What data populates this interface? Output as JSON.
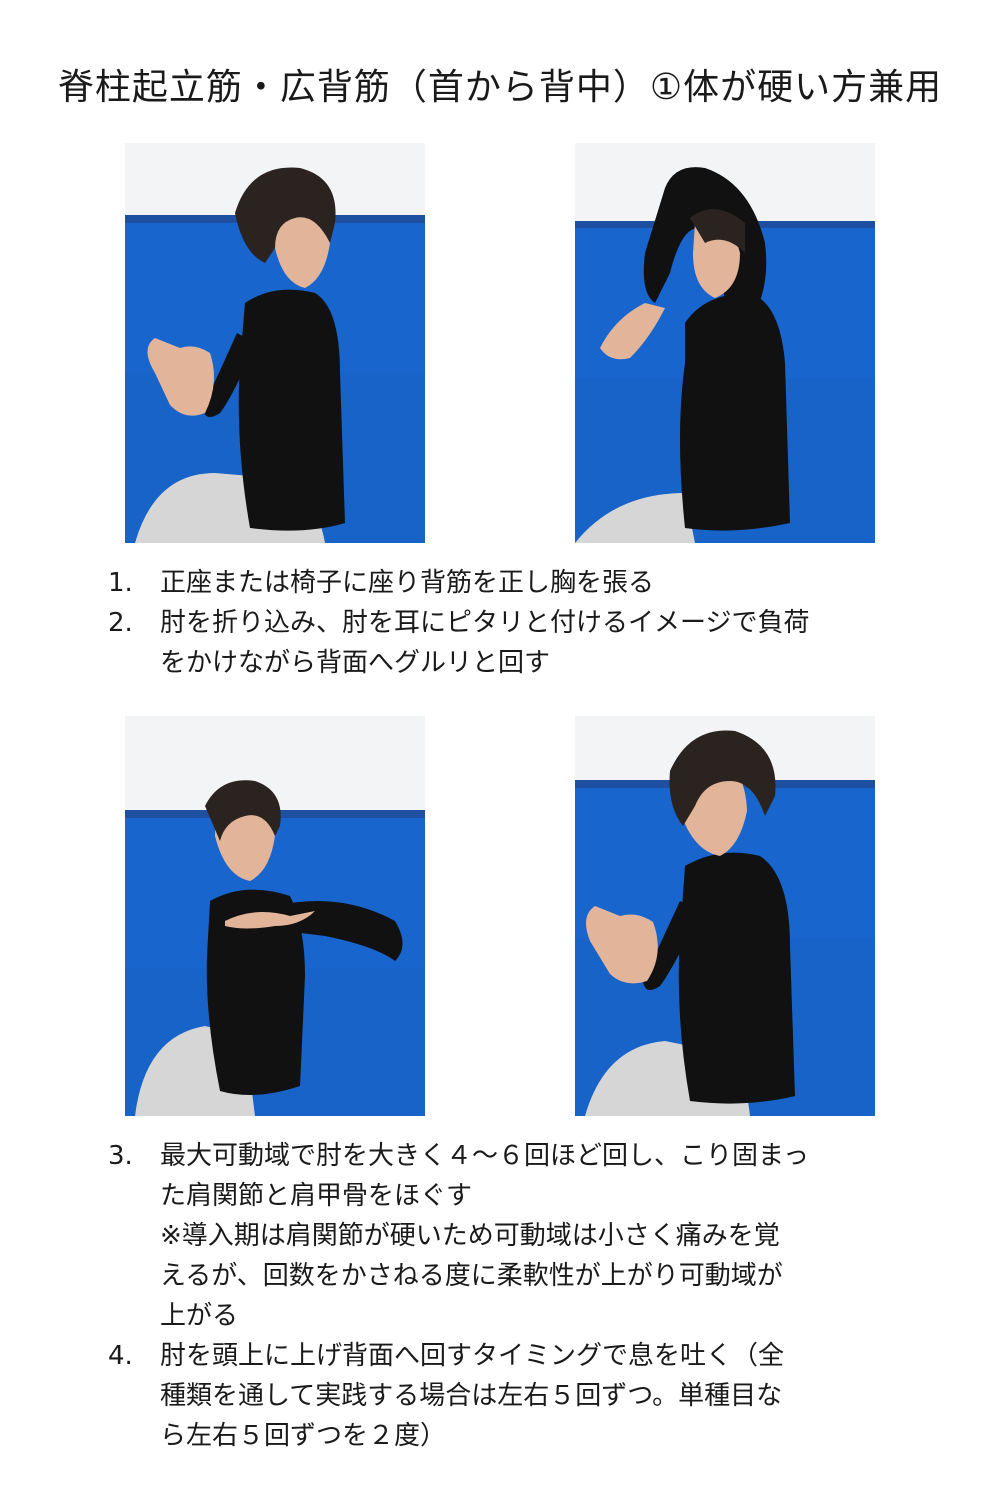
{
  "page": {
    "title": "脊柱起立筋・広背筋（首から背中）①体が硬い方兼用"
  },
  "colors": {
    "mat_blue": "#1763c8",
    "wall_white": "#f3f4f5",
    "shirt_black": "#111111",
    "skin": "#e2b49a",
    "pants_gray": "#d6d6d6"
  },
  "photos": [
    {
      "icon": "person-seated-elbow-front-photo"
    },
    {
      "icon": "person-elbow-raised-overhead-photo"
    },
    {
      "icon": "person-arm-rotated-back-photo"
    },
    {
      "icon": "person-seated-elbow-front-photo"
    }
  ],
  "steps_group_1": [
    {
      "num": "1.",
      "text": "正座または椅子に座り背筋を正し胸を張る"
    },
    {
      "num": "2.",
      "text": "肘を折り込み、肘を耳にピタリと付けるイメージで負荷\nをかけながら背面へグルリと回す"
    }
  ],
  "steps_group_2": [
    {
      "num": "3.",
      "text": "最大可動域で肘を大きく４～６回ほど回し、こり固まっ\nた肩関節と肩甲骨をほぐす\n※導入期は肩関節が硬いため可動域は小さく痛みを覚\nえるが、回数をかさねる度に柔軟性が上がり可動域が\n上がる"
    },
    {
      "num": "4.",
      "text": "肘を頭上に上げ背面へ回すタイミングで息を吐く（全\n種類を通して実践する場合は左右５回ずつ。単種目な\nら左右５回ずつを２度）"
    }
  ]
}
